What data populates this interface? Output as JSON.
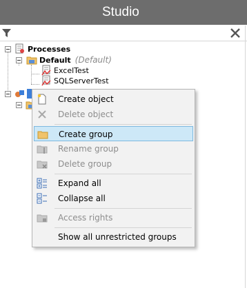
{
  "window": {
    "title": "Studio"
  },
  "filter": {
    "value": "",
    "filter_icon": "funnel-icon",
    "clear_icon": "close-icon"
  },
  "tree": {
    "processes": {
      "label": "Processes",
      "icon": "processes-icon"
    },
    "default_group": {
      "label": "Default",
      "note": "(Default)",
      "icon": "folder-icon"
    },
    "items": [
      {
        "label": "ExcelTest",
        "icon": "process-icon"
      },
      {
        "label": "SQLServerTest",
        "icon": "process-icon"
      }
    ],
    "second_root": {
      "icon": "objects-icon"
    }
  },
  "context_menu": {
    "items": [
      {
        "label": "Create object",
        "enabled": true,
        "icon": "new-document-icon"
      },
      {
        "label": "Delete object",
        "enabled": false,
        "icon": "delete-x-icon"
      },
      {
        "label": "Create group",
        "enabled": true,
        "highlighted": true,
        "icon": "new-folder-icon"
      },
      {
        "label": "Rename group",
        "enabled": false,
        "icon": "rename-folder-icon"
      },
      {
        "label": "Delete group",
        "enabled": false,
        "icon": "delete-folder-icon"
      },
      {
        "label": "Expand all",
        "enabled": true,
        "icon": "expand-all-icon"
      },
      {
        "label": "Collapse all",
        "enabled": true,
        "icon": "collapse-all-icon"
      },
      {
        "label": "Access rights",
        "enabled": false,
        "icon": "lock-folder-icon"
      },
      {
        "label": "Show all unrestricted groups",
        "enabled": true,
        "icon": ""
      }
    ]
  },
  "colors": {
    "titlebar": "#6d6d6d",
    "highlight": "#cde8f7",
    "highlight_border": "#7db9e0"
  }
}
